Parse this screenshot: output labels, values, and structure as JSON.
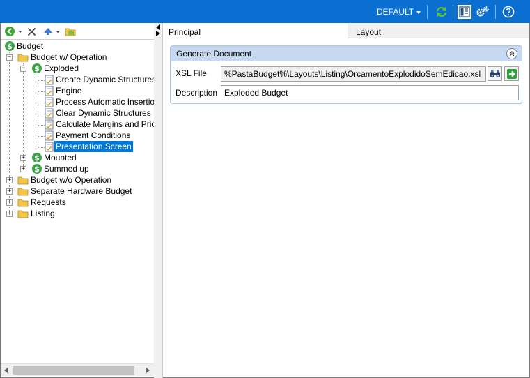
{
  "toolbar": {
    "profile_label": "DEFAULT",
    "icons": [
      "refresh-icon",
      "panel-layout-icon",
      "settings-gears-icon",
      "help-icon"
    ]
  },
  "left_toolbar": {
    "icons": [
      "back-circle-icon",
      "delete-x-icon",
      "arrow-up-icon",
      "folder-icon"
    ]
  },
  "tree": {
    "nodes": [
      {
        "label": "Budget",
        "icon": "budget-dollar-icon"
      },
      {
        "label": "Budget w/ Operation",
        "icon": "folder-icon"
      },
      {
        "label": "Exploded",
        "icon": "budget-dollar-icon"
      },
      {
        "label": "Create Dynamic Structures",
        "icon": "step-document-icon"
      },
      {
        "label": "Engine",
        "icon": "step-document-icon"
      },
      {
        "label": "Process Automatic Insertions",
        "icon": "step-document-icon"
      },
      {
        "label": "Clear Dynamic Structures",
        "icon": "step-document-icon"
      },
      {
        "label": "Calculate Margins and Prices",
        "icon": "step-document-icon"
      },
      {
        "label": "Payment Conditions",
        "icon": "step-document-icon"
      },
      {
        "label": "Presentation Screen",
        "icon": "step-document-icon"
      },
      {
        "label": "Mounted",
        "icon": "budget-dollar-icon"
      },
      {
        "label": "Summed up",
        "icon": "budget-dollar-icon"
      },
      {
        "label": "Budget w/o Operation",
        "icon": "folder-icon"
      },
      {
        "label": "Separate Hardware Budget",
        "icon": "folder-icon"
      },
      {
        "label": "Requests",
        "icon": "folder-icon"
      },
      {
        "label": "Listing",
        "icon": "folder-icon"
      }
    ]
  },
  "tabs": [
    {
      "label": "Principal"
    },
    {
      "label": "Layout"
    }
  ],
  "group": {
    "title": "Generate Document",
    "xsl_label": "XSL File",
    "xsl_value": "%PastaBudget%\\Layouts\\Listing\\OrcamentoExplodidoSemEdicao.xsl",
    "description_label": "Description",
    "description_value": "Exploded Budget"
  },
  "colors": {
    "top_bar": "#0b6fd2",
    "selection": "#0078d7",
    "group_header": "#c7d9f1"
  }
}
